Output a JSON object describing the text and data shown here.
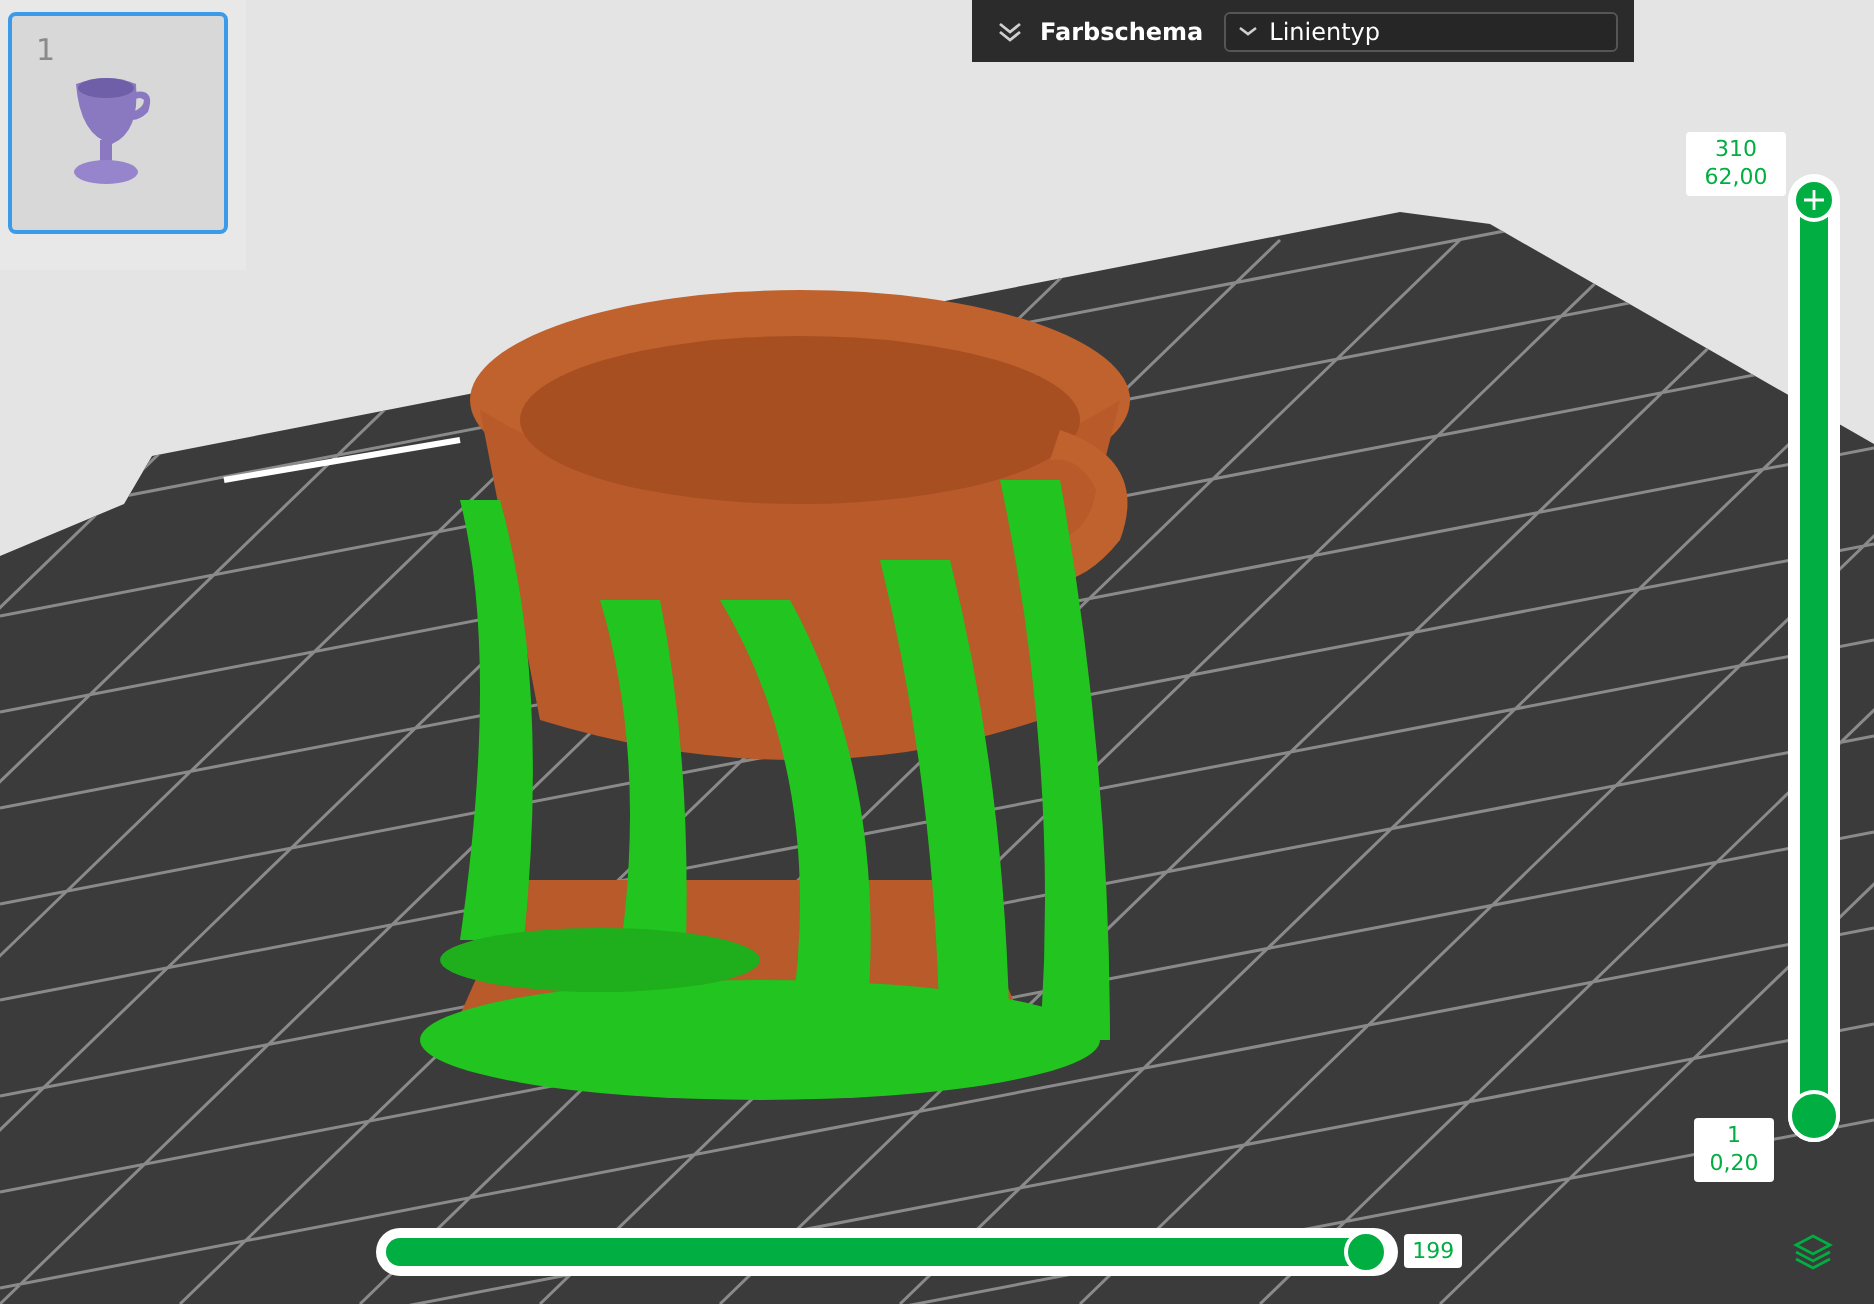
{
  "thumbnails": [
    {
      "label": "1",
      "selected": true
    }
  ],
  "toolbar": {
    "title": "Farbschema",
    "dropdown": {
      "value": "Linientyp"
    }
  },
  "layer_slider": {
    "upper": {
      "lines": [
        "310",
        "62,00"
      ],
      "level": 1
    },
    "lower": {
      "lines": [
        "1",
        "0,20"
      ],
      "level": 0
    }
  },
  "move_slider": {
    "level": 0.99,
    "label": "199"
  }
}
